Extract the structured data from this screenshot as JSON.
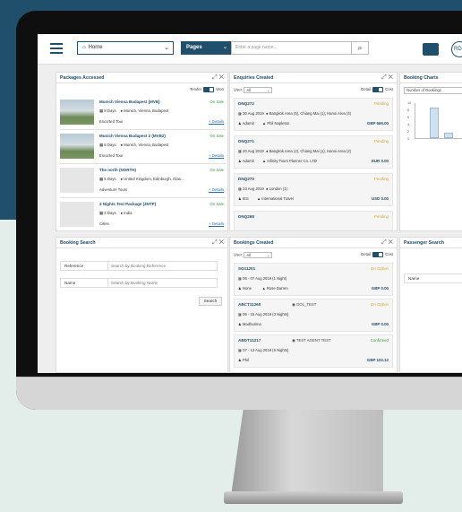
{
  "topbar": {
    "home_label": "Home",
    "pages_label": "Pages",
    "page_search_placeholder": "Enter a page name...",
    "avatar_initials": "RD"
  },
  "packages": {
    "title": "Packages Accessed",
    "toggle_left": "Tender",
    "toggle_right": "Won",
    "items": [
      {
        "name": "Munich Vienna Budapest (MVB)",
        "status": "On Sale",
        "days": "8 Days",
        "location": "Munich, Vienna, Budapest",
        "type": "Escorted Tour",
        "details": "+ Details"
      },
      {
        "name": "Munich Vienna Budapest 2 (MVB2)",
        "status": "On Sale",
        "days": "8 Days",
        "location": "Munich, Vienna, Budapest",
        "type": "Escorted Tour",
        "details": "+ Details"
      },
      {
        "name": "The north (NORTH)",
        "status": "On Sale",
        "days": "5 Days",
        "location": "United Kingdom, Edinburgh, Glas...",
        "type": "Adventure Tours",
        "details": "+ Details"
      },
      {
        "name": "3 Nights Test Package (3NTP)",
        "status": "On Sale",
        "days": "3 Days",
        "location": "India",
        "type": "Cities",
        "details": "+ Details"
      }
    ]
  },
  "enquiries": {
    "title": "Enquiries Created",
    "user_label": "User:",
    "user_value": "All",
    "detail_label": "Detail",
    "cost_label": "Cost",
    "items": [
      {
        "id": "DNQ272",
        "status": "Pending",
        "dates": "30 Aug 2019",
        "regions": "Bangkok Area (5), Chiang Mai (1), Hanoi Area (4)",
        "user": "Adamit",
        "contact": "Phil Napleton",
        "amount": "GBP 665.00"
      },
      {
        "id": "DNQ271",
        "status": "Pending",
        "dates": "20 Aug 2019",
        "regions": "Bangkok Area (2), Chiang Mai (1), Hanoi Area (2)",
        "user": "Adamit",
        "contact": "Infinity Tours Planner Co. LTD",
        "amount": "EUR 0.00"
      },
      {
        "id": "DNQ270",
        "status": "Pending",
        "dates": "23 Aug 2019",
        "regions": "London (1)",
        "user": "IES",
        "contact": "International Travel",
        "amount": "USD 0.00"
      },
      {
        "id": "DNQ268",
        "status": "Pending",
        "dates": "",
        "regions": "",
        "user": "",
        "contact": "",
        "amount": ""
      }
    ]
  },
  "booking_charts": {
    "title": "Booking Charts",
    "select_value": "Number of Bookings",
    "y_ticks": [
      "10",
      "8",
      "6",
      "4",
      "2",
      "0"
    ]
  },
  "booking_search": {
    "title": "Booking Search",
    "reference_label": "Reference",
    "reference_placeholder": "Search by Booking Reference",
    "name_label": "Name",
    "name_placeholder": "Search by Booking Name",
    "search_button": "Search"
  },
  "bookings": {
    "title": "Bookings Created",
    "user_label": "User:",
    "user_value": "All",
    "detail_label": "Detail",
    "cost_label": "Cost",
    "items": [
      {
        "id": "SG11201",
        "status": "On Option",
        "dates": "06 - 07 Aug 2019 (1 Night)",
        "user": "None",
        "contact": "Rose Darren",
        "amount": "GBP 0.00",
        "confirmed": false
      },
      {
        "id": "ABCT11260",
        "status": "On Option",
        "dates": "06 - 15 Aug 2019 (3 Nights)",
        "user": "Madhurima",
        "contact": "GOL_TEST",
        "amount": "GBP 0.00",
        "confirmed": false
      },
      {
        "id": "ABDT11217",
        "status": "Confirmed",
        "dates": "07 - 13 Aug 2019 (6 Nights)",
        "user": "Phil",
        "contact": "TEST AGENT TEST",
        "amount": "GBP 102.12",
        "confirmed": true
      }
    ]
  },
  "passenger_search": {
    "title": "Passenger Search",
    "name_label": "Name"
  }
}
